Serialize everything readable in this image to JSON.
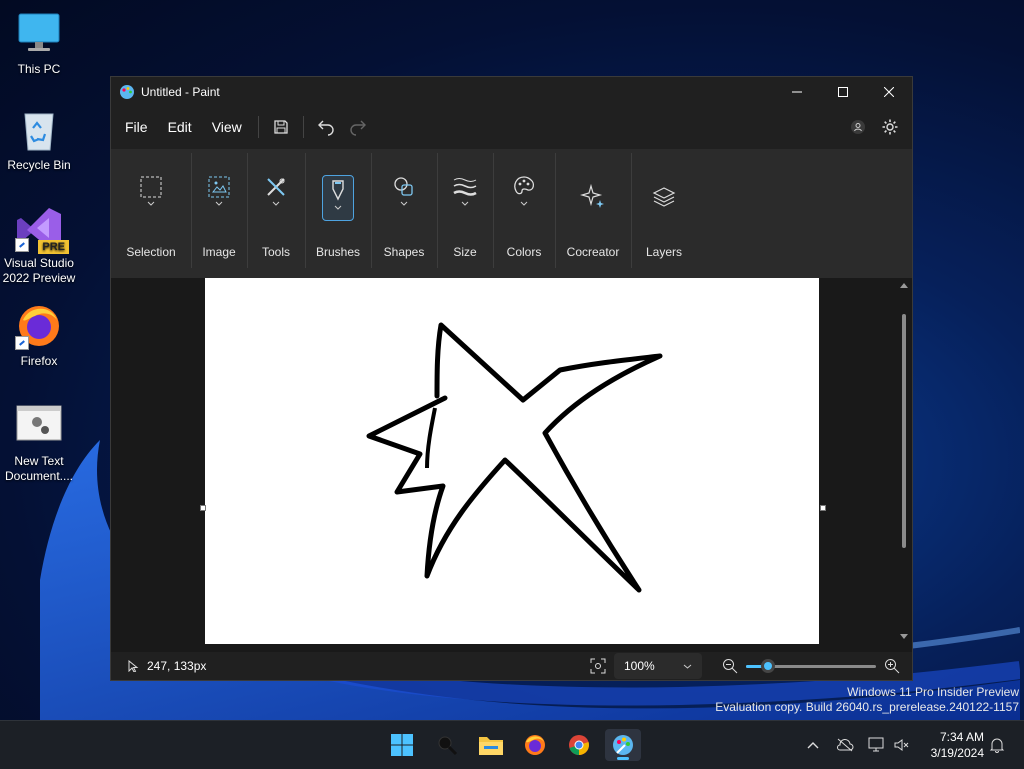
{
  "desktop": {
    "icons": [
      {
        "label": "This PC",
        "icon": "monitor-icon"
      },
      {
        "label": "Recycle Bin",
        "icon": "recycle-bin-icon"
      },
      {
        "label": "Visual Studio 2022 Preview",
        "badge": "PRE",
        "icon": "visual-studio-icon"
      },
      {
        "label": "Firefox",
        "icon": "firefox-icon"
      },
      {
        "label": "New Text Document....",
        "icon": "text-document-icon"
      }
    ]
  },
  "window": {
    "title": "Untitled - Paint",
    "menu": [
      "File",
      "Edit",
      "View"
    ],
    "ribbon_groups": [
      {
        "label": "Selection",
        "icon": "selection-icon"
      },
      {
        "label": "Image",
        "icon": "image-icon"
      },
      {
        "label": "Tools",
        "icon": "tools-icon"
      },
      {
        "label": "Brushes",
        "icon": "brush-icon",
        "active": true
      },
      {
        "label": "Shapes",
        "icon": "shapes-icon"
      },
      {
        "label": "Size",
        "icon": "size-icon"
      },
      {
        "label": "Colors",
        "icon": "palette-icon"
      },
      {
        "label": "Cocreator",
        "icon": "sparkle-icon"
      },
      {
        "label": "Layers",
        "icon": "layers-icon"
      }
    ],
    "status": {
      "cursor_position": "247, 133px",
      "zoom": "100%",
      "zoom_slider_fraction": 0.17
    }
  },
  "watermark": {
    "line1": "Windows 11 Pro Insider Preview",
    "line2": "Evaluation copy. Build 26040.rs_prerelease.240122-1157"
  },
  "taskbar": {
    "time": "7:34 AM",
    "date": "3/19/2024"
  },
  "colors": {
    "accent": "#4cc2ff",
    "window_bg": "#202020",
    "ribbon_bg": "#2b2b2b",
    "canvas": "#ffffff"
  }
}
